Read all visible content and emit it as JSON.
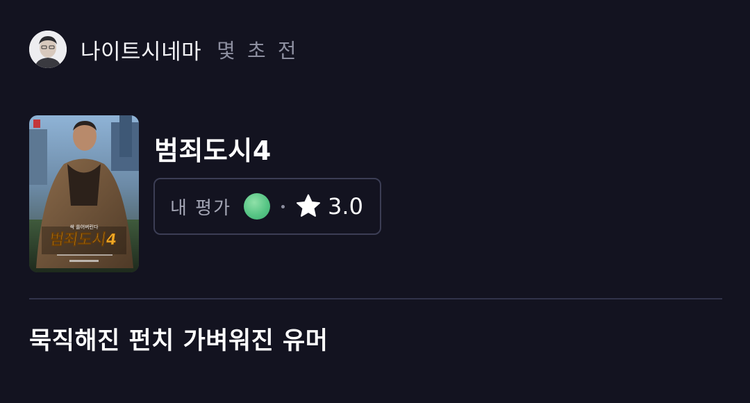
{
  "header": {
    "username": "나이트시네마",
    "time_ago": "몇 초 전",
    "avatar_icon": "user-avatar"
  },
  "movie": {
    "title": "범죄도시4",
    "poster": {
      "tagline": "싹 쓸어버린다",
      "title_art": "범죄도시4"
    }
  },
  "rating": {
    "label": "내 평가",
    "value": "3.0",
    "dot_color": "#57c585",
    "star_icon": "star-icon"
  },
  "review": {
    "text": "묵직해진 펀치 가벼워진 유머"
  },
  "colors": {
    "background": "#131320",
    "border": "#3c3e55",
    "muted_text": "#8d8fa0"
  }
}
